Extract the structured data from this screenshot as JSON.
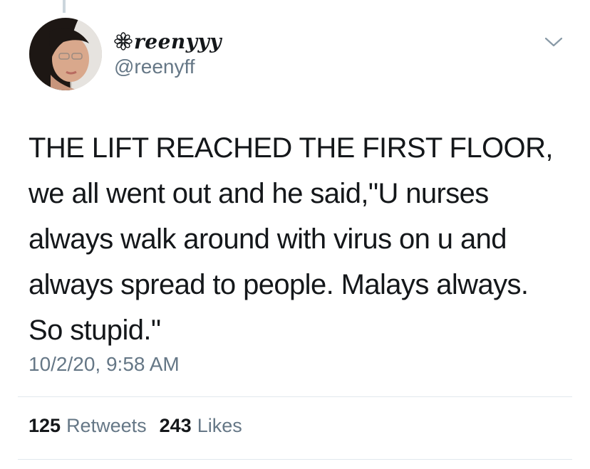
{
  "tweet": {
    "author": {
      "display_name": "reenyyy",
      "name_prefix_icon": "flower-outline-icon",
      "handle": "@reenyff",
      "avatar": "profile-photo"
    },
    "menu_icon": "chevron-down-icon",
    "text": "THE LIFT REACHED THE FIRST FLOOR,\nwe all went out and he said,\"U nurses\nalways walk around with virus on u and\nalways spread to people. Malays always.\nSo stupid.\"",
    "timestamp": "10/2/20, 9:58 AM",
    "stats": {
      "retweets_count": "125",
      "retweets_label": "Retweets",
      "likes_count": "243",
      "likes_label": "Likes"
    }
  },
  "colors": {
    "text_primary": "#14171a",
    "text_secondary": "#657786",
    "divider": "#e1e8ed",
    "thread_line": "#ccd6dd"
  }
}
